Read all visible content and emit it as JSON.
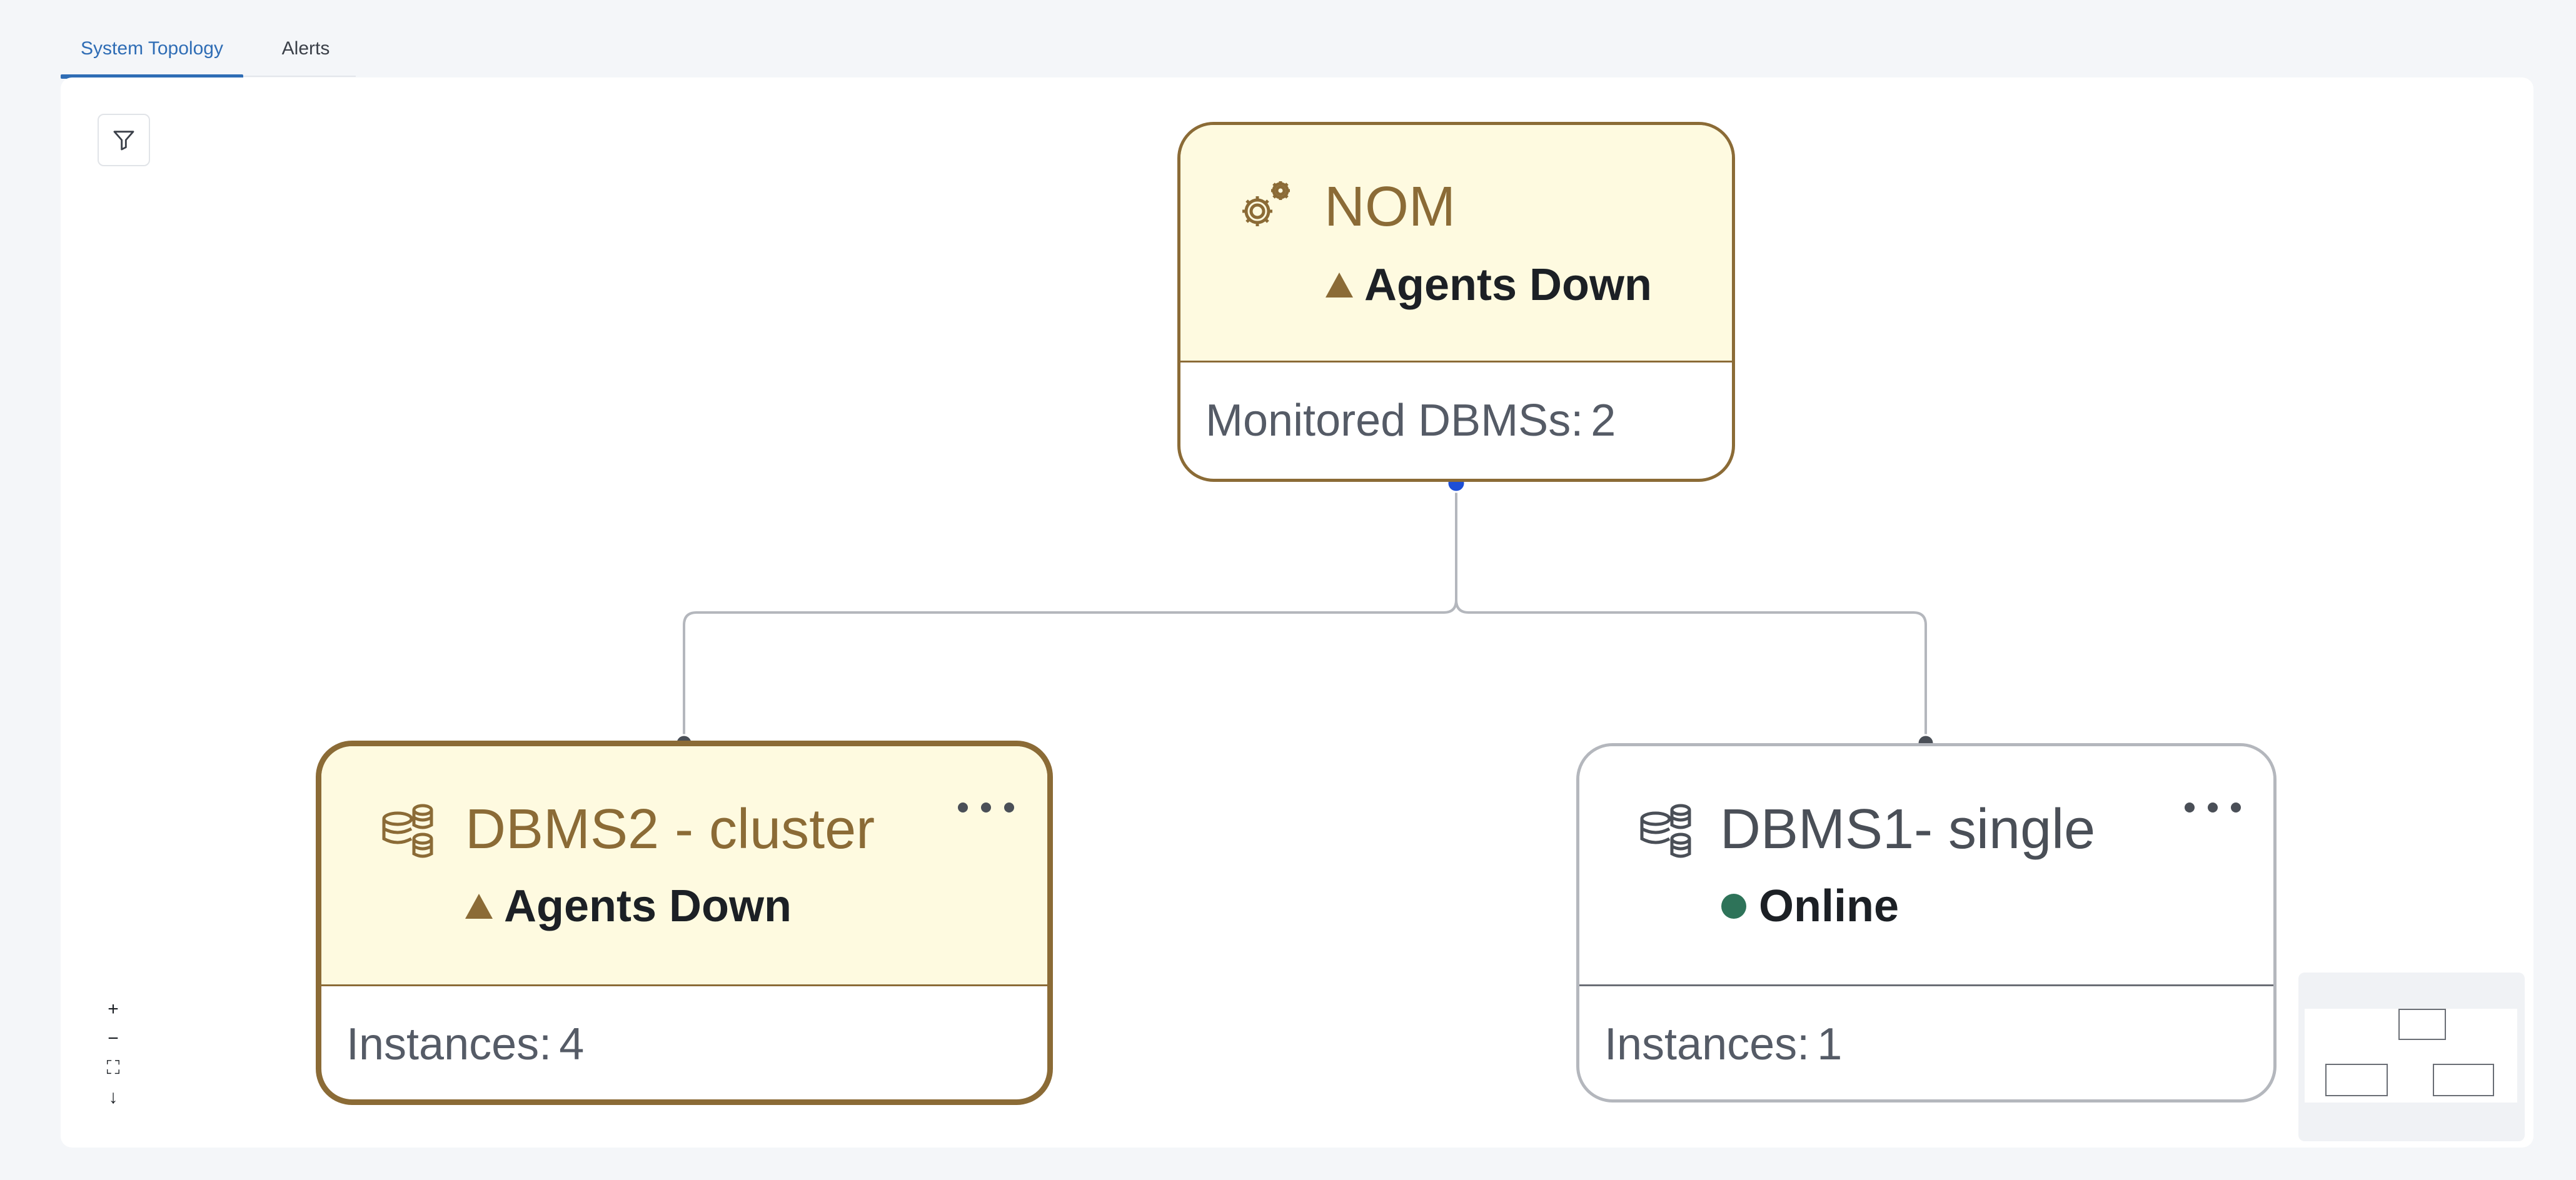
{
  "tabs": [
    {
      "label": "System Topology",
      "active": true
    },
    {
      "label": "Alerts",
      "active": false
    }
  ],
  "toolbar": {
    "filter_icon": "filter-icon"
  },
  "nodes": {
    "nom": {
      "icon": "gears-icon",
      "title": "NOM",
      "status": "Agents Down",
      "status_icon": "warning-triangle-icon",
      "detail_label": "Monitored DBMSs:",
      "detail_value": "2"
    },
    "dbms2": {
      "icon": "database-cluster-icon",
      "title": "DBMS2 - cluster",
      "status": "Agents Down",
      "status_icon": "warning-triangle-icon",
      "detail_label": "Instances:",
      "detail_value": "4"
    },
    "dbms1": {
      "icon": "database-cluster-icon",
      "title": "DBMS1- single",
      "status": "Online",
      "status_icon": "online-dot-icon",
      "detail_label": "Instances:",
      "detail_value": "1"
    }
  },
  "zoom_controls": {
    "zoom_in": "+",
    "zoom_out": "−",
    "fit": "⛶",
    "download": "↓"
  },
  "colors": {
    "warning": "#8b6b36",
    "warning_bg": "#fefae0",
    "online": "#2e7359",
    "accent": "#2f6db5",
    "handle_active": "#1d4fd6",
    "handle": "#4a4f57",
    "edge": "#b4b7bd"
  }
}
